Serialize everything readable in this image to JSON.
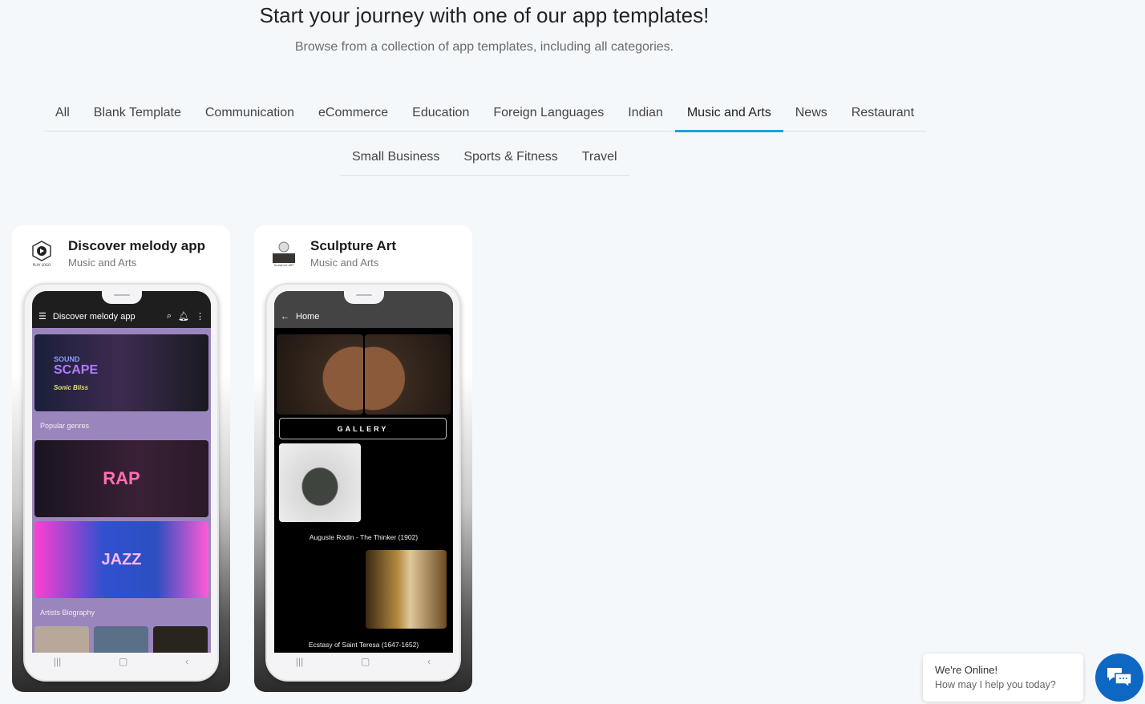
{
  "header": {
    "title": "Start your journey with one of our app templates!",
    "subtitle": "Browse from a collection of app templates, including all categories."
  },
  "tabs_row1": [
    "All",
    "Blank Template",
    "Communication",
    "eCommerce",
    "Education",
    "Foreign Languages",
    "Indian",
    "Music and Arts",
    "News",
    "Restaurant"
  ],
  "tabs_row2": [
    "Small Business",
    "Sports & Fitness",
    "Travel"
  ],
  "active_tab": "Music and Arts",
  "accent_color": "#1ea0dc",
  "cards": [
    {
      "name": "Discover melody app",
      "category": "Music and Arts",
      "logo_text": "PLAY LOGO",
      "screen": {
        "appbar_title": "Discover melody app",
        "banner_title_1": "SOUND",
        "banner_title_2": "SCAPE",
        "banner_script": "Sonic Bliss",
        "section1": "Popular genres",
        "genre1": "RAP",
        "genre2": "JAZZ",
        "section2": "Artists Biography"
      }
    },
    {
      "name": "Sculpture Art",
      "category": "Music and Arts",
      "logo_text": "Sculpture ART",
      "screen": {
        "appbar_title": "Home",
        "button": "GALLERY",
        "caption1": "Auguste Rodin - The Thinker (1902)",
        "caption2": "Ecstasy of Saint Teresa (1647-1652)"
      }
    }
  ],
  "chat": {
    "title": "We're Online!",
    "message": "How may I help you today?",
    "color": "#0f67c4"
  }
}
